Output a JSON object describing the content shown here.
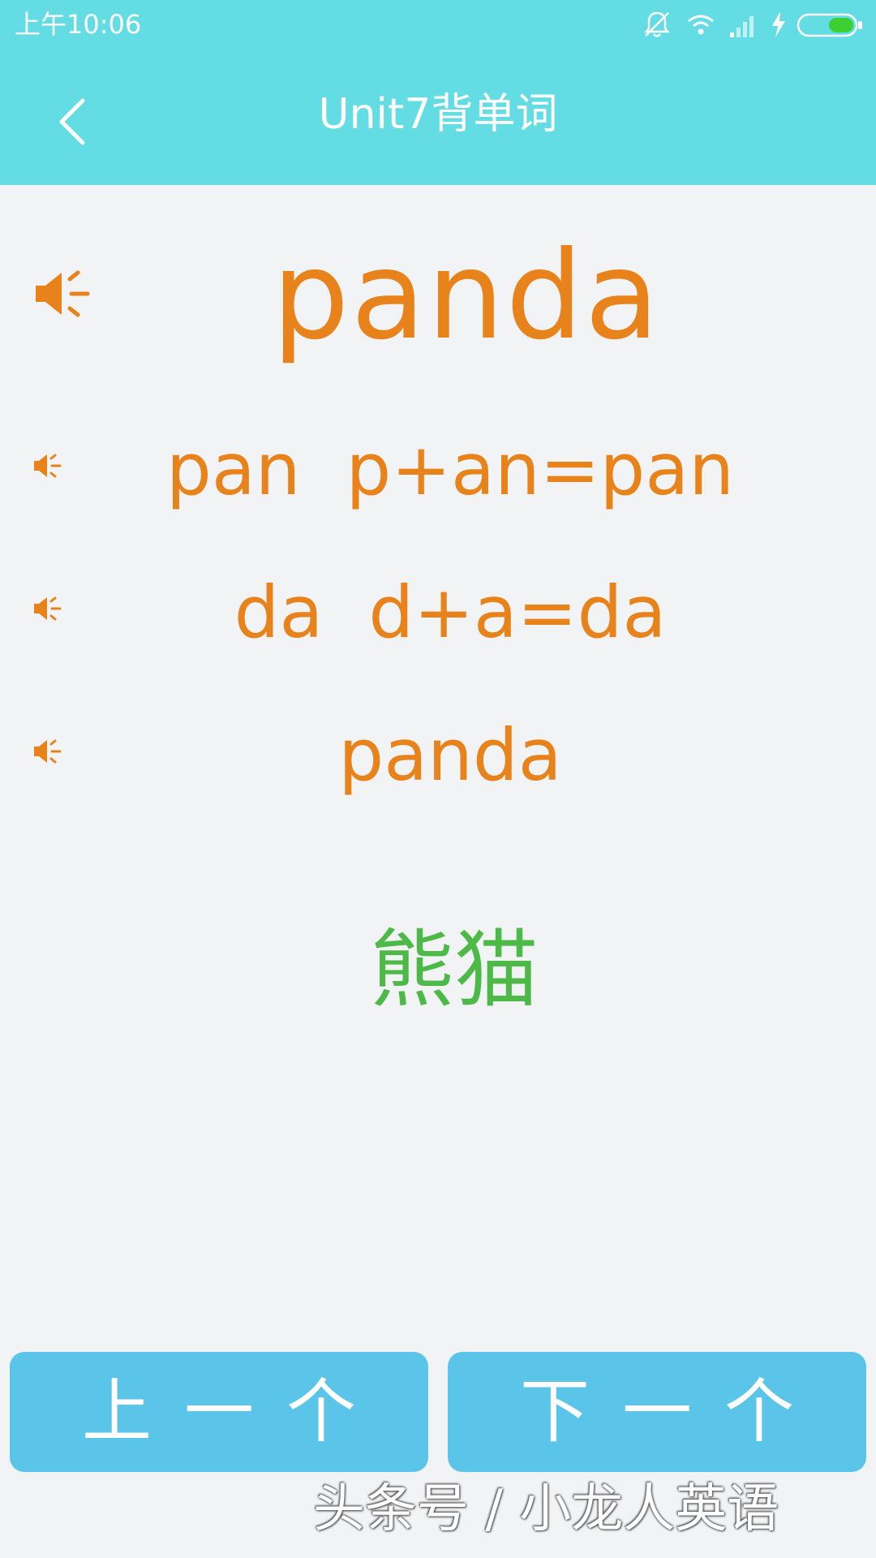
{
  "status_bar": {
    "time": "上午10:06",
    "icons": [
      "mute-icon",
      "wifi-icon",
      "signal-icon",
      "charging-icon",
      "battery-icon"
    ]
  },
  "header": {
    "title": "Unit7背单词",
    "back_icon": "chevron-left-icon"
  },
  "word": "panda",
  "syllables": [
    {
      "text": "pan  p+an=pan"
    },
    {
      "text": "da  d+a=da"
    },
    {
      "text": "panda"
    }
  ],
  "meaning": "熊猫",
  "buttons": {
    "prev": "上一个",
    "next": "下一个"
  },
  "watermark": "头条号 / 小龙人英语",
  "colors": {
    "header_bg": "#63dce4",
    "accent_orange": "#e8831b",
    "meaning_green": "#4dba48",
    "button_bg": "#5bc5e9",
    "page_bg": "#f2f3f5"
  }
}
